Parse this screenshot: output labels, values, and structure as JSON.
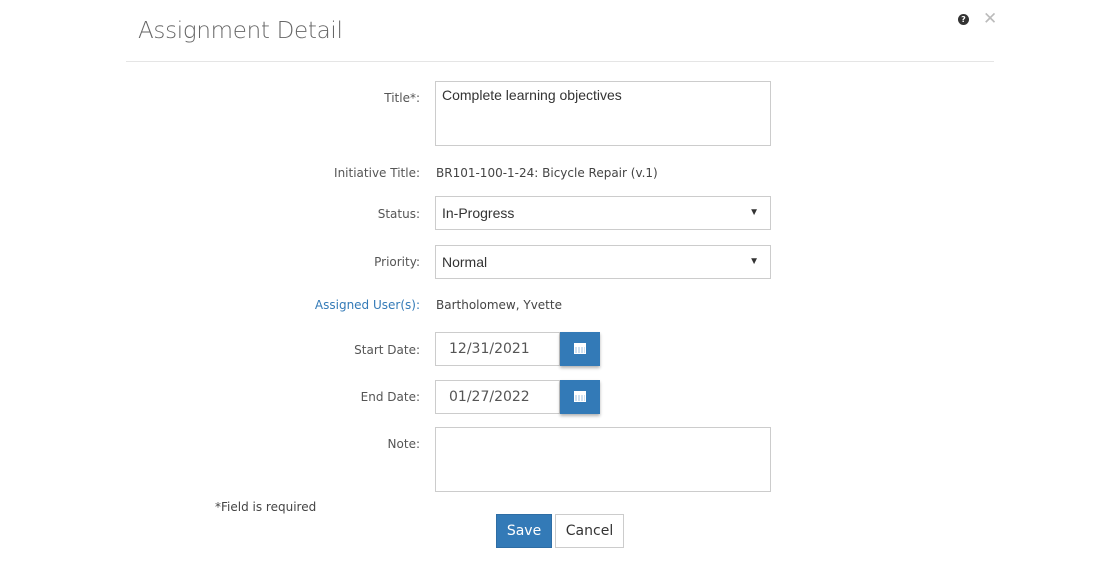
{
  "header": {
    "title": "Assignment Detail",
    "help_icon": "question-circle-icon",
    "close_icon": "close-icon"
  },
  "form": {
    "title_label": "Title*:",
    "title_value": "Complete learning objectives",
    "initiative_label": "Initiative Title:",
    "initiative_value": "BR101-100-1-24: Bicycle Repair (v.1)",
    "status_label": "Status:",
    "status_value": "In-Progress",
    "priority_label": "Priority:",
    "priority_value": "Normal",
    "assigned_label": "Assigned User(s):",
    "assigned_value": "Bartholomew, Yvette",
    "start_label": "Start Date:",
    "start_value": "12/31/2021",
    "end_label": "End Date:",
    "end_value": "01/27/2022",
    "note_label": "Note:",
    "note_value": "",
    "required_note": "*Field is required",
    "dropdown_arrow": "▼"
  },
  "buttons": {
    "save": "Save",
    "cancel": "Cancel"
  },
  "colors": {
    "primary": "#337ab7"
  }
}
